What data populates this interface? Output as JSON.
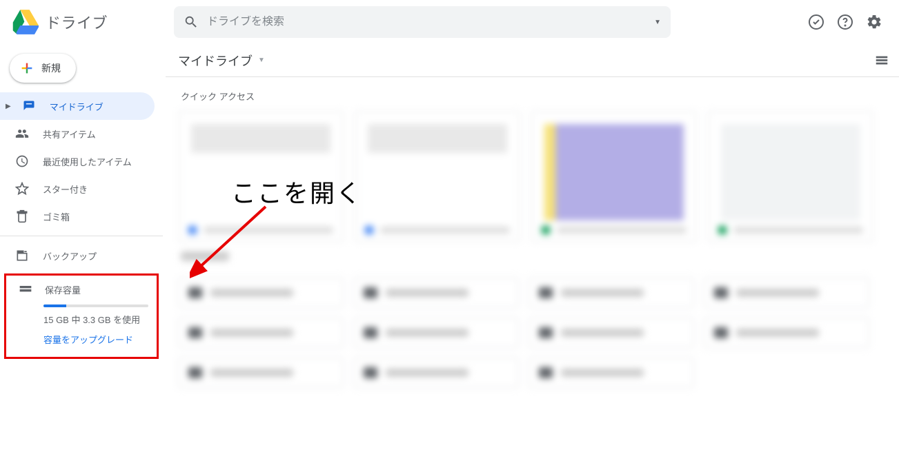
{
  "app": {
    "title": "ドライブ"
  },
  "search": {
    "placeholder": "ドライブを検索"
  },
  "sidebar": {
    "new_label": "新規",
    "items": [
      {
        "label": "マイドライブ"
      },
      {
        "label": "共有アイテム"
      },
      {
        "label": "最近使用したアイテム"
      },
      {
        "label": "スター付き"
      },
      {
        "label": "ゴミ箱"
      }
    ],
    "backup_label": "バックアップ",
    "storage": {
      "heading": "保存容量",
      "usage_text": "15 GB 中 3.3 GB を使用",
      "upgrade_label": "容量をアップグレード",
      "percent_used": 22
    }
  },
  "breadcrumb": {
    "current": "マイドライブ"
  },
  "quick_access_label": "クイック アクセス",
  "annotation": {
    "text": "ここを開く"
  }
}
